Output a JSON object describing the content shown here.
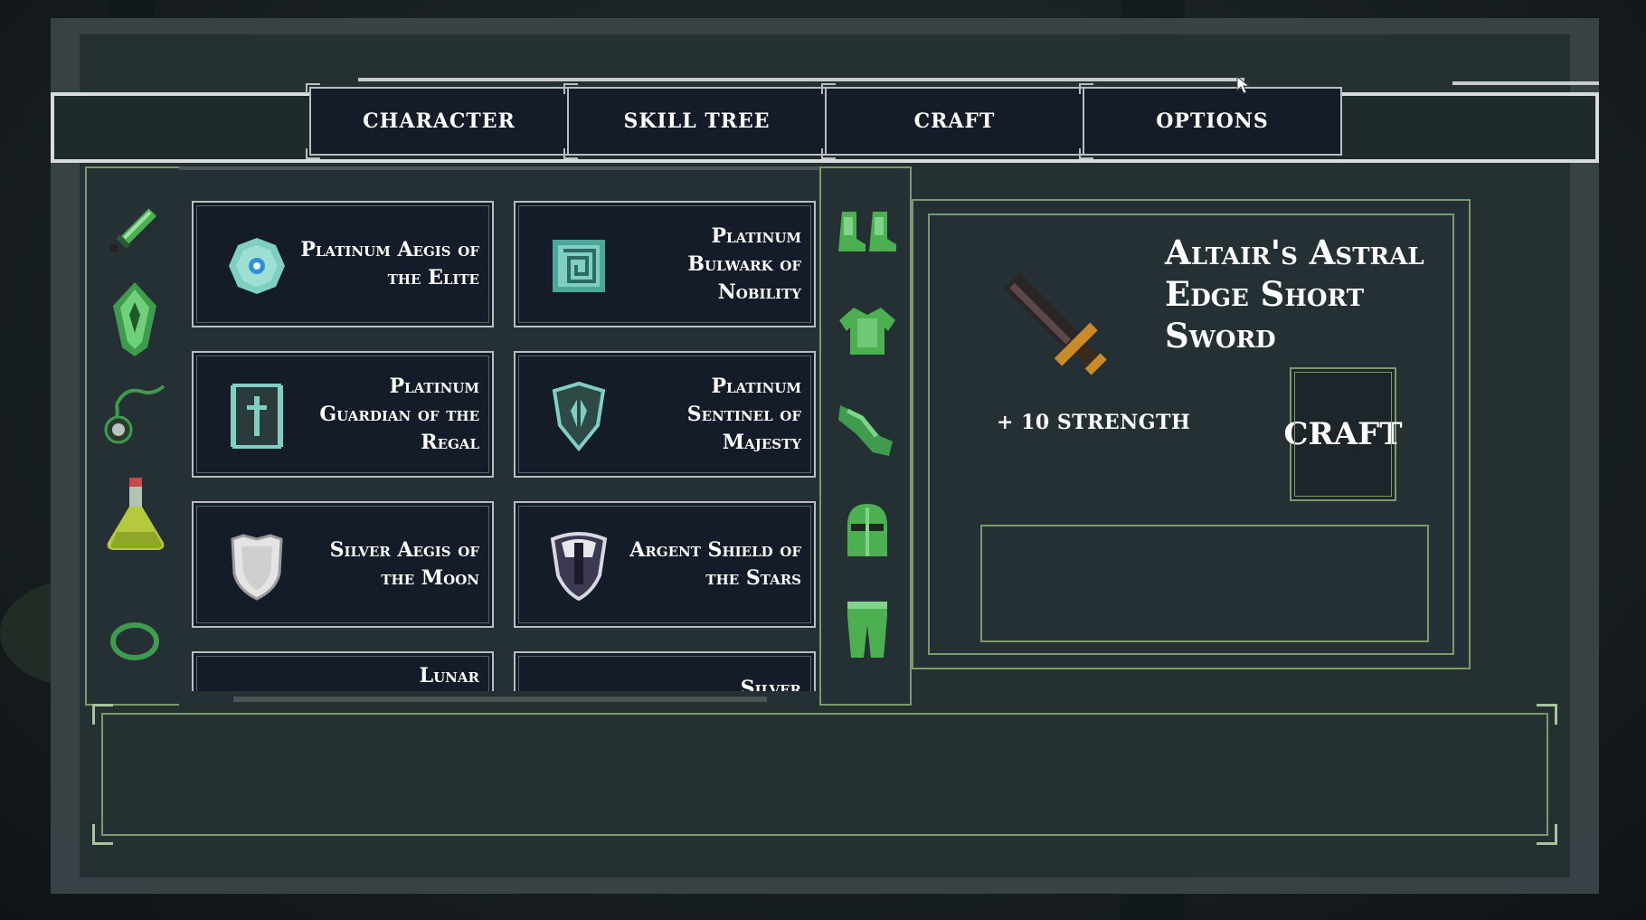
{
  "tabs": [
    {
      "label": "CHARACTER"
    },
    {
      "label": "SKILL TREE"
    },
    {
      "label": "CRAFT"
    },
    {
      "label": "OPTIONS"
    }
  ],
  "categories": [
    {
      "icon": "sword-icon"
    },
    {
      "icon": "crystal-shield-icon"
    },
    {
      "icon": "amulet-icon"
    },
    {
      "icon": "potion-icon"
    },
    {
      "icon": "ring-icon"
    }
  ],
  "items": [
    {
      "name": "Platinum Aegis of the Elite",
      "icon": "round-shield-icon"
    },
    {
      "name": "Platinum Bulwark of Nobility",
      "icon": "square-shield-icon"
    },
    {
      "name": "Platinum Guardian of the Regal",
      "icon": "tower-shield-icon"
    },
    {
      "name": "Platinum Sentinel of Majesty",
      "icon": "kite-shield-icon"
    },
    {
      "name": "Silver Aegis of the Moon",
      "icon": "heater-shield-icon"
    },
    {
      "name": "Argent Shield of the Stars",
      "icon": "crest-shield-icon"
    },
    {
      "name": "Lunar",
      "icon": "partial-shield-icon"
    },
    {
      "name": "Silver",
      "icon": "partial-shield-icon"
    }
  ],
  "equipment": [
    {
      "icon": "boots-icon"
    },
    {
      "icon": "chest-armor-icon"
    },
    {
      "icon": "gauntlet-icon"
    },
    {
      "icon": "helmet-icon"
    },
    {
      "icon": "leg-armor-icon"
    }
  ],
  "detail": {
    "title": "Altair's Astral Edge Short Sword",
    "stat": "+ 10 STRENGTH",
    "craft_label": "CRAFT",
    "icon": "short-sword-icon"
  },
  "colors": {
    "accent_green": "#7b9a6b",
    "card_bg": "#141c29",
    "panel_bg": "#243034"
  }
}
